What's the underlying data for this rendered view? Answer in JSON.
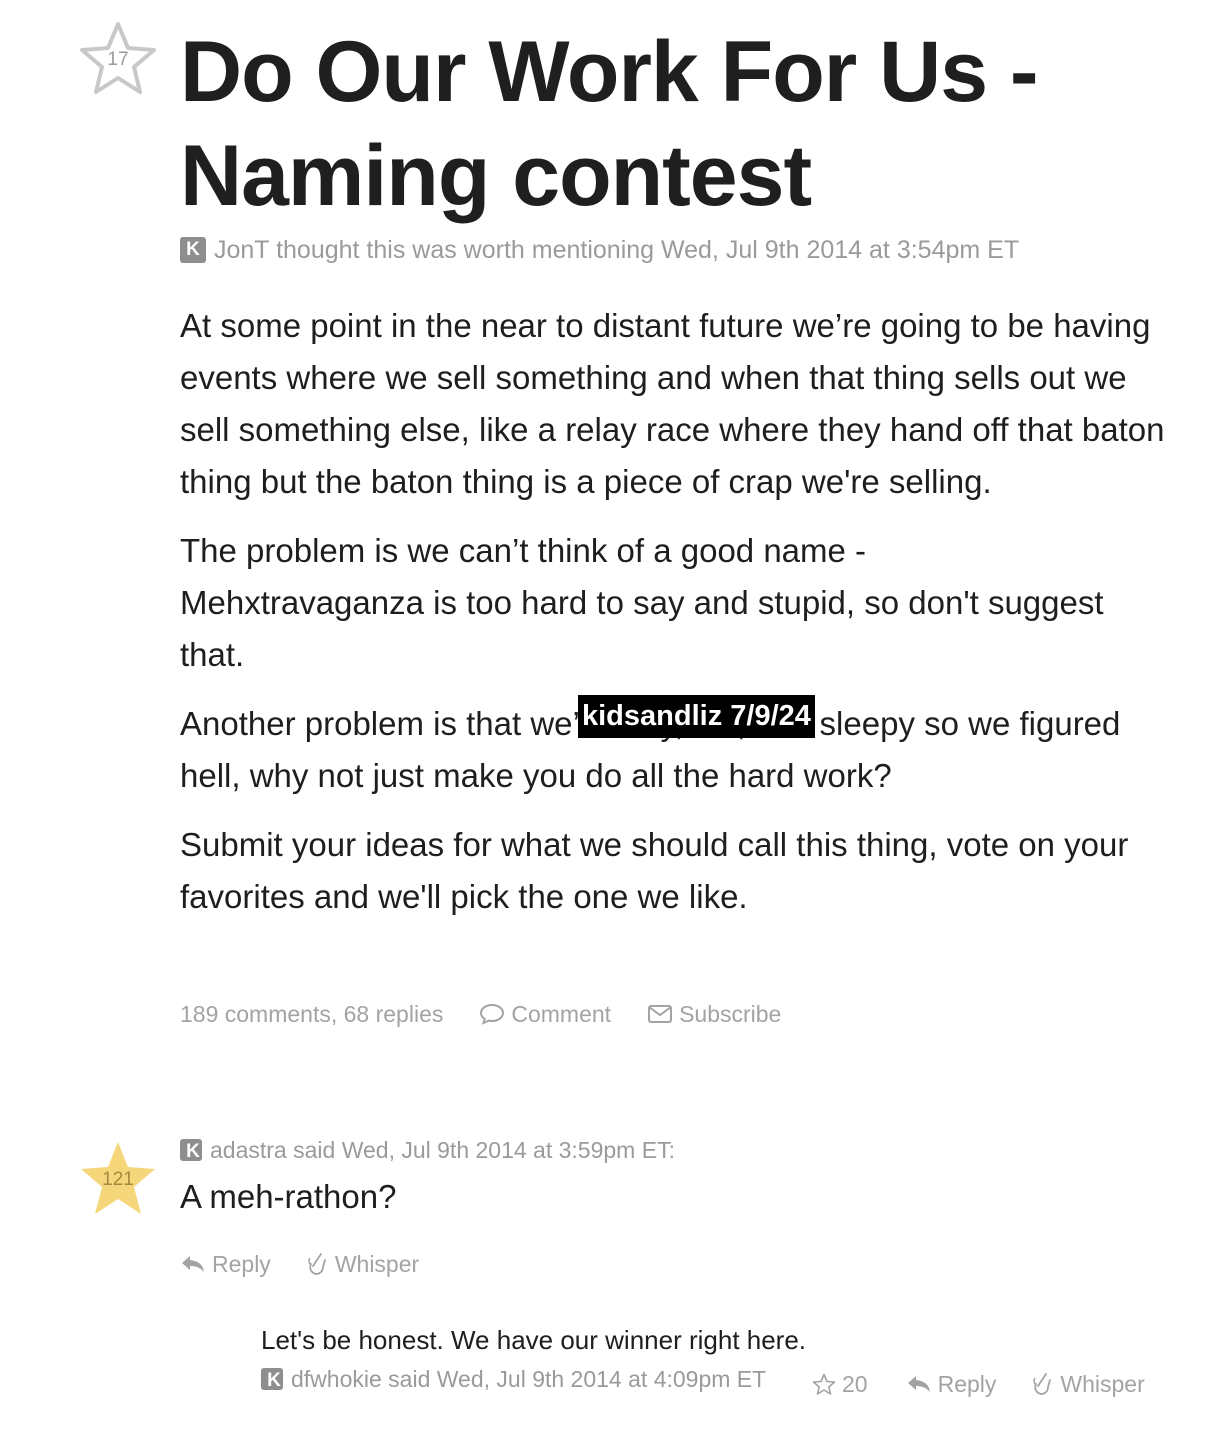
{
  "post": {
    "star_count": "17",
    "title": "Do Our Work For Us - Naming contest",
    "author": "JonT",
    "meta_text": "JonT thought this was worth mentioning Wed, Jul 9th 2014 at 3:54pm ET",
    "paragraphs": [
      "At some point in the near to distant future we’re going to be having events where we sell something and when that thing sells out we sell something else, like a relay race where they hand off that baton thing but the baton thing is a piece of crap we're selling.",
      "The problem is we can’t think of a good name - Mehxtravaganza is too hard to say and stupid, so don't suggest that.",
      "Another problem is that we’re lazy, old, and sleepy so we figured hell, why not just make you do all the hard work?",
      "Submit your ideas for what we should call this thing, vote on your favorites and we'll pick the one we like."
    ],
    "watermark": "kidsandliz 7/9/24",
    "counts_text": "189 comments, 68 replies",
    "comment_label": "Comment",
    "subscribe_label": "Subscribe"
  },
  "comment": {
    "star_count": "121",
    "meta_text": "adastra said Wed, Jul 9th 2014 at 3:59pm ET:",
    "text": "A meh-rathon?",
    "reply_label": "Reply",
    "whisper_label": "Whisper"
  },
  "reply": {
    "text": "Let's be honest. We have our winner right here.",
    "meta_text": "dfwhokie said Wed, Jul 9th 2014 at 4:09pm ET",
    "star_count": "20",
    "reply_label": "Reply",
    "whisper_label": "Whisper"
  },
  "colors": {
    "gray_text": "#9a9a9a",
    "star_outline": "#c8c8c8",
    "star_gold": "#f5d67a",
    "watermark_bg": "#000000"
  },
  "icons": [
    "star-outline-icon",
    "star-filled-icon",
    "k-badge-icon",
    "speech-bubble-icon",
    "envelope-icon",
    "reply-arrow-icon",
    "whisper-hand-icon"
  ]
}
